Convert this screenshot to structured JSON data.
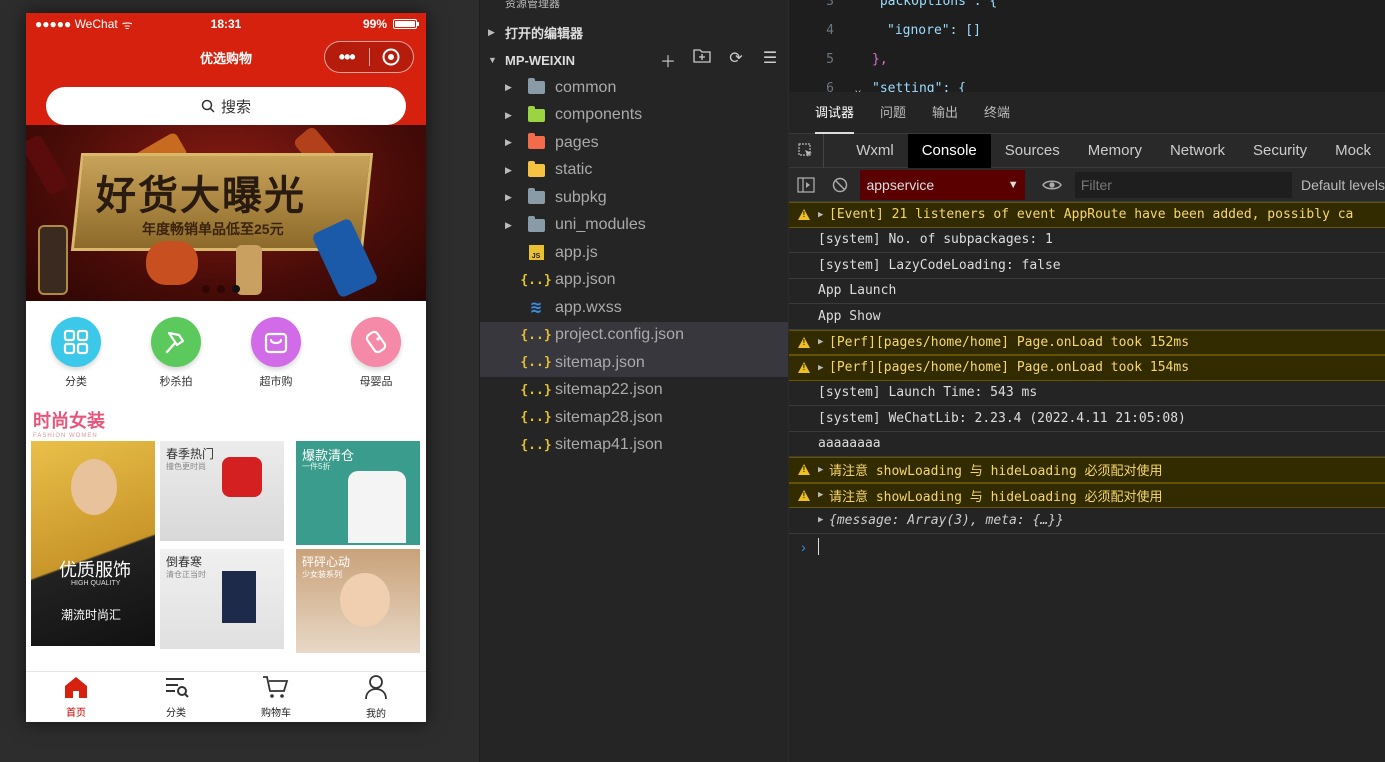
{
  "simulator": {
    "status_bar": {
      "carrier": "●●●●● WeChat",
      "time": "18:31",
      "battery": "99%",
      "battery_level": 0.99
    },
    "nav_title": "优选购物",
    "search_placeholder": "搜索",
    "banner": {
      "title": "好货大曝光",
      "subtitle": "年度畅销单品低至25元",
      "dot_count": 3,
      "active_dot": 2
    },
    "categories": [
      {
        "label": "分类",
        "icon": "grid-icon",
        "color": "#3cc8e8"
      },
      {
        "label": "秒杀拍",
        "icon": "hammer-icon",
        "color": "#5cc95c"
      },
      {
        "label": "超市购",
        "icon": "shopping-bag-icon",
        "color": "#d16be8"
      },
      {
        "label": "母婴品",
        "icon": "baby-bottle-icon",
        "color": "#f58aa8"
      }
    ],
    "floor": {
      "title": "时尚女装",
      "title_en": "FASHION WOMEN",
      "main_tile": {
        "title": "优质服饰",
        "subtitle": "HIGH QUALITY",
        "caption": "潮流时尚汇"
      },
      "tiles": [
        {
          "title": "春季热门",
          "subtitle": "撞色更时尚"
        },
        {
          "title": "爆款清仓",
          "subtitle": "一件5折"
        },
        {
          "title": "倒春寒",
          "subtitle": "清仓正当时"
        },
        {
          "title": "砰砰心动",
          "subtitle": "少女装系列"
        }
      ]
    },
    "tabbar": [
      {
        "label": "首页",
        "icon": "home-icon",
        "active": true
      },
      {
        "label": "分类",
        "icon": "list-search-icon",
        "active": false
      },
      {
        "label": "购物车",
        "icon": "cart-icon",
        "active": false
      },
      {
        "label": "我的",
        "icon": "user-icon",
        "active": false
      }
    ]
  },
  "explorer": {
    "header": "资源管理器",
    "open_editors": "打开的编辑器",
    "project": "MP-WEIXIN",
    "items": [
      {
        "name": "common",
        "type": "folder",
        "color": "#8a9ba8"
      },
      {
        "name": "components",
        "type": "folder",
        "color": "#9bd343"
      },
      {
        "name": "pages",
        "type": "folder",
        "color": "#f26b4a"
      },
      {
        "name": "static",
        "type": "folder",
        "color": "#f5c242"
      },
      {
        "name": "subpkg",
        "type": "folder",
        "color": "#8a9ba8"
      },
      {
        "name": "uni_modules",
        "type": "folder",
        "color": "#8a9ba8"
      },
      {
        "name": "app.js",
        "type": "js"
      },
      {
        "name": "app.json",
        "type": "json"
      },
      {
        "name": "app.wxss",
        "type": "css"
      },
      {
        "name": "project.config.json",
        "type": "json",
        "selected": true
      },
      {
        "name": "sitemap.json",
        "type": "json",
        "selected": true
      },
      {
        "name": "sitemap22.json",
        "type": "json"
      },
      {
        "name": "sitemap28.json",
        "type": "json"
      },
      {
        "name": "sitemap41.json",
        "type": "json"
      }
    ]
  },
  "editor": {
    "lines": [
      {
        "num": "3",
        "text": "\"packOptions\": {"
      },
      {
        "num": "4",
        "text": "\"ignore\": []"
      },
      {
        "num": "5",
        "text": "},"
      },
      {
        "num": "6",
        "text": "\"setting\": {"
      }
    ]
  },
  "debugger": {
    "top_tabs": [
      "调试器",
      "问题",
      "输出",
      "终端"
    ],
    "panel_tabs": [
      "Wxml",
      "Console",
      "Sources",
      "Memory",
      "Network",
      "Security",
      "Mock"
    ],
    "active_panel": "Console",
    "context": "appservice",
    "filter_placeholder": "Filter",
    "levels": "Default levels",
    "logs": [
      {
        "level": "warn",
        "expandable": true,
        "text": "[Event] 21 listeners of event AppRoute have been added, possibly ca"
      },
      {
        "level": "info",
        "text": "[system] No. of subpackages: 1"
      },
      {
        "level": "info",
        "text": "[system] LazyCodeLoading: false"
      },
      {
        "level": "info",
        "text": "App Launch"
      },
      {
        "level": "info",
        "text": "App Show"
      },
      {
        "level": "warn",
        "expandable": true,
        "text": "[Perf][pages/home/home] Page.onLoad took 152ms"
      },
      {
        "level": "warn",
        "expandable": true,
        "text": "[Perf][pages/home/home] Page.onLoad took 154ms"
      },
      {
        "level": "info",
        "text": "[system] Launch Time: 543 ms"
      },
      {
        "level": "info",
        "text": "[system] WeChatLib: 2.23.4 (2022.4.11 21:05:08)"
      },
      {
        "level": "info",
        "text": "aaaaaaaa"
      },
      {
        "level": "warn",
        "expandable": true,
        "text": "请注意 showLoading 与 hideLoading 必须配对使用"
      },
      {
        "level": "warn",
        "expandable": true,
        "text": "请注意 showLoading 与 hideLoading 必须配对使用"
      },
      {
        "level": "object",
        "expandable": true,
        "text": "{message: Array(3), meta: {…}}"
      }
    ]
  }
}
